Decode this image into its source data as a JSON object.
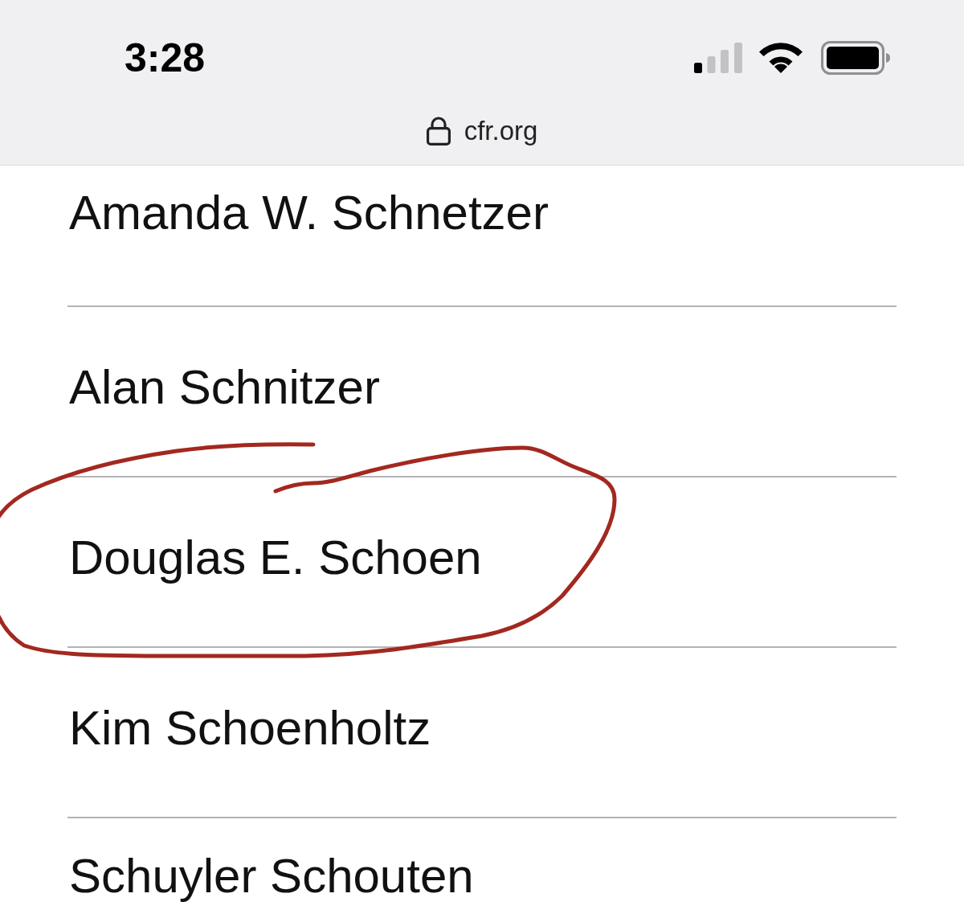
{
  "status_bar": {
    "time": "3:28"
  },
  "address_bar": {
    "url": "cfr.org",
    "secure": true
  },
  "names": [
    {
      "name": "Amanda W. Schnetzer",
      "circled": false
    },
    {
      "name": "Alan Schnitzer",
      "circled": false
    },
    {
      "name": "Douglas E. Schoen",
      "circled": true
    },
    {
      "name": "Kim Schoenholtz",
      "circled": false
    },
    {
      "name": "Schuyler Schouten",
      "circled": false
    }
  ]
}
